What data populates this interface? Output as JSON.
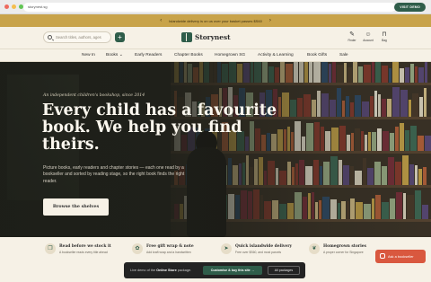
{
  "browser": {
    "url": "storynest.sg",
    "visit_label": "VISIT DEMO"
  },
  "announcement": {
    "text": "Islandwide delivery is on us over your basket passes $S60",
    "prev": "‹",
    "next": "›"
  },
  "header": {
    "search_placeholder": "Search titles, authors, ages",
    "add_symbol": "+",
    "logo": "Storynest",
    "icons": [
      {
        "name": "finder-icon",
        "label": "Finder"
      },
      {
        "name": "account-icon",
        "label": "Account"
      },
      {
        "name": "bag-icon",
        "label": "Bag"
      }
    ]
  },
  "nav": {
    "items": [
      "New In",
      "Books",
      "Early Readers",
      "Chapter Books",
      "Homegrown SG",
      "Activity & Learning",
      "Book Gifts",
      "Sale"
    ],
    "books_chevron": "⌄"
  },
  "hero": {
    "eyebrow": "An independent children's bookshop, since 2014",
    "headline": "Every child has a favourite book. We help you find theirs.",
    "subtext": "Picture books, early readers and chapter stories — each one read by a bookseller and sorted by reading stage, so the right book finds the right reader.",
    "cta": "Browse the shelves"
  },
  "features": [
    {
      "icon": "book-icon",
      "glyph": "❐",
      "title": "Read before we stock it",
      "desc": "A bookseller reads every title ahead"
    },
    {
      "icon": "gift-icon",
      "glyph": "✿",
      "title": "Free gift wrap & note",
      "desc": "Add kraft wrap and a handwritten"
    },
    {
      "icon": "truck-icon",
      "glyph": "➤",
      "title": "Quick islandwide delivery",
      "desc": "Free over $S60, and most parcels"
    },
    {
      "icon": "leaf-icon",
      "glyph": "❦",
      "title": "Homegrown stories",
      "desc": "A proper corner for Singapore"
    }
  ],
  "demo_bar": {
    "text_pre": "Live demo of the ",
    "text_bold": "Online Store",
    "text_post": " package.",
    "customise": "Customise & buy this site →",
    "all_packages": "All packages"
  },
  "ask": {
    "label": "Ask a bookseller"
  }
}
